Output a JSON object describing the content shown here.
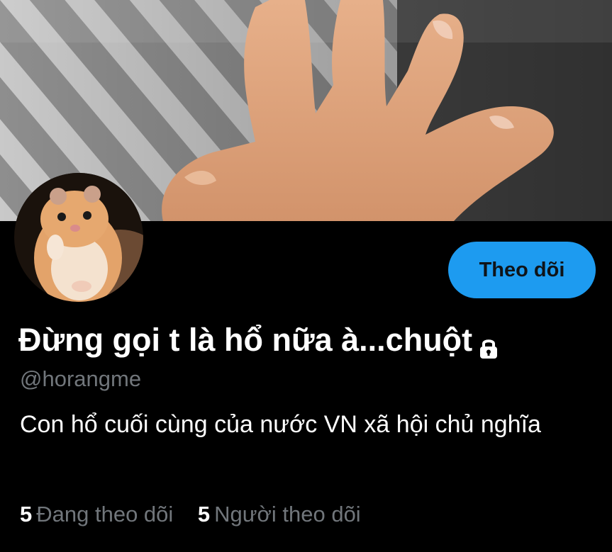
{
  "profile": {
    "display_name": "Đừng gọi t là hổ nữa à...chuột",
    "handle": "@horangme",
    "bio": "Con hổ cuối cùng của nước VN xã hội chủ nghĩa",
    "protected_icon": "lock-icon",
    "banner_description": "hand-photo-banner",
    "avatar_description": "hamster-avatar"
  },
  "actions": {
    "follow_label": "Theo dõi"
  },
  "stats": {
    "following_count": "5",
    "following_label": "Đang theo dõi",
    "followers_count": "5",
    "followers_label": "Người theo dõi"
  },
  "colors": {
    "background": "#000000",
    "accent": "#1d9bf0",
    "secondary_text": "#71767b",
    "primary_text": "#ffffff"
  }
}
